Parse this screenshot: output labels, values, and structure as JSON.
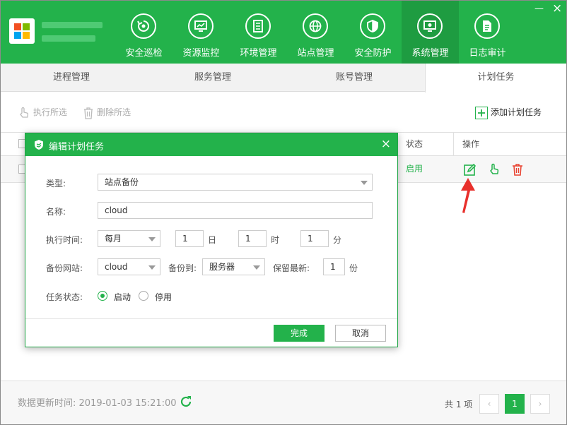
{
  "nav": [
    {
      "label": "安全巡检",
      "icon": "refresh-shield-icon"
    },
    {
      "label": "资源监控",
      "icon": "monitor-chart-icon"
    },
    {
      "label": "环境管理",
      "icon": "server-stack-icon"
    },
    {
      "label": "站点管理",
      "icon": "globe-icon"
    },
    {
      "label": "安全防护",
      "icon": "shield-icon"
    },
    {
      "label": "系统管理",
      "icon": "system-monitor-icon",
      "active": true
    },
    {
      "label": "日志审计",
      "icon": "document-icon"
    }
  ],
  "window": {
    "minimize": "—",
    "close": "×"
  },
  "tabs": [
    "进程管理",
    "服务管理",
    "账号管理",
    "计划任务"
  ],
  "active_tab": "计划任务",
  "toolbar": {
    "execute": "执行所选",
    "delete": "删除所选",
    "add": "添加计划任务"
  },
  "table": {
    "headers": {
      "status": "状态",
      "actions": "操作"
    },
    "rows": [
      {
        "status": "启用"
      }
    ]
  },
  "dialog": {
    "title": "编辑计划任务",
    "close": "×",
    "type_label": "类型:",
    "type_value": "站点备份",
    "name_label": "名称:",
    "name_value": "cloud",
    "time_label": "执行时间:",
    "period_value": "每月",
    "day_value": "1",
    "day_unit": "日",
    "hour_value": "1",
    "hour_unit": "时",
    "minute_value": "1",
    "minute_unit": "分",
    "site_label": "备份网站:",
    "site_value": "cloud",
    "backup_to_label": "备份到:",
    "backup_to_value": "服务器",
    "keep_label": "保留最新:",
    "keep_value": "1",
    "keep_unit": "份",
    "state_label": "任务状态:",
    "state_on": "启动",
    "state_off": "停用",
    "ok": "完成",
    "cancel": "取消"
  },
  "footer": {
    "update_text": "数据更新时间: 2019-01-03 15:21:00",
    "total": "共 1 项",
    "page": "1",
    "prev": "‹",
    "next": "›"
  },
  "colors": {
    "accent": "#23b24b",
    "accent_dark": "#1e9c41",
    "danger": "#e8412f",
    "arrow": "#e8302c"
  }
}
